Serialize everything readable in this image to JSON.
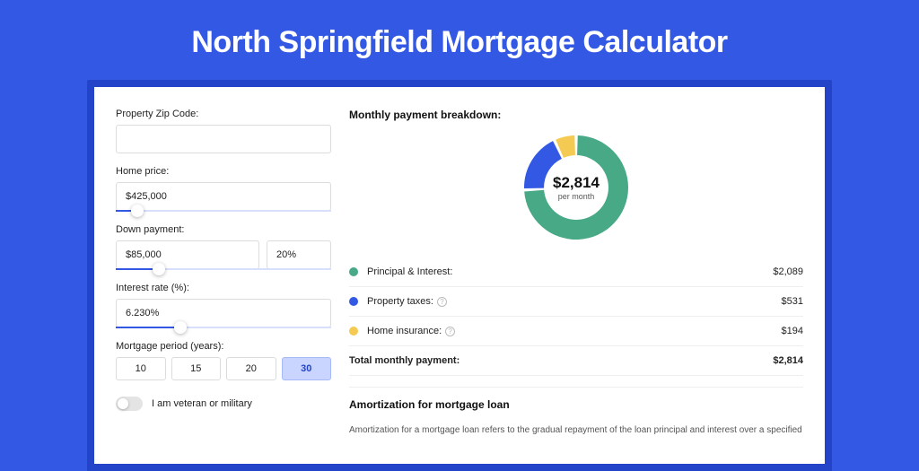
{
  "title": "North Springfield Mortgage Calculator",
  "form": {
    "zip_label": "Property Zip Code:",
    "zip_value": "",
    "home_price_label": "Home price:",
    "home_price_value": "$425,000",
    "home_price_slider_pct": 10,
    "down_payment_label": "Down payment:",
    "down_payment_value": "$85,000",
    "down_payment_pct": "20%",
    "down_payment_slider_pct": 20,
    "interest_label": "Interest rate (%):",
    "interest_value": "6.230%",
    "interest_slider_pct": 30,
    "period_label": "Mortgage period (years):",
    "period_options": [
      "10",
      "15",
      "20",
      "30"
    ],
    "period_selected": "30",
    "veteran_label": "I am veteran or military"
  },
  "breakdown": {
    "title": "Monthly payment breakdown:",
    "center_value": "$2,814",
    "center_sub": "per month",
    "rows": [
      {
        "label": "Principal & Interest:",
        "amount": "$2,089",
        "color": "#47a986",
        "has_info": false
      },
      {
        "label": "Property taxes:",
        "amount": "$531",
        "color": "#3358e4",
        "has_info": true
      },
      {
        "label": "Home insurance:",
        "amount": "$194",
        "color": "#f4ca52",
        "has_info": true
      }
    ],
    "total_label": "Total monthly payment:",
    "total_amount": "$2,814"
  },
  "chart_data": {
    "type": "pie",
    "title": "Monthly payment breakdown",
    "series": [
      {
        "name": "Principal & Interest",
        "value": 2089,
        "color": "#47a986"
      },
      {
        "name": "Property taxes",
        "value": 531,
        "color": "#3358e4"
      },
      {
        "name": "Home insurance",
        "value": 194,
        "color": "#f4ca52"
      }
    ],
    "total": 2814,
    "inner_radius_ratio": 0.62
  },
  "amort": {
    "title": "Amortization for mortgage loan",
    "body": "Amortization for a mortgage loan refers to the gradual repayment of the loan principal and interest over a specified"
  }
}
